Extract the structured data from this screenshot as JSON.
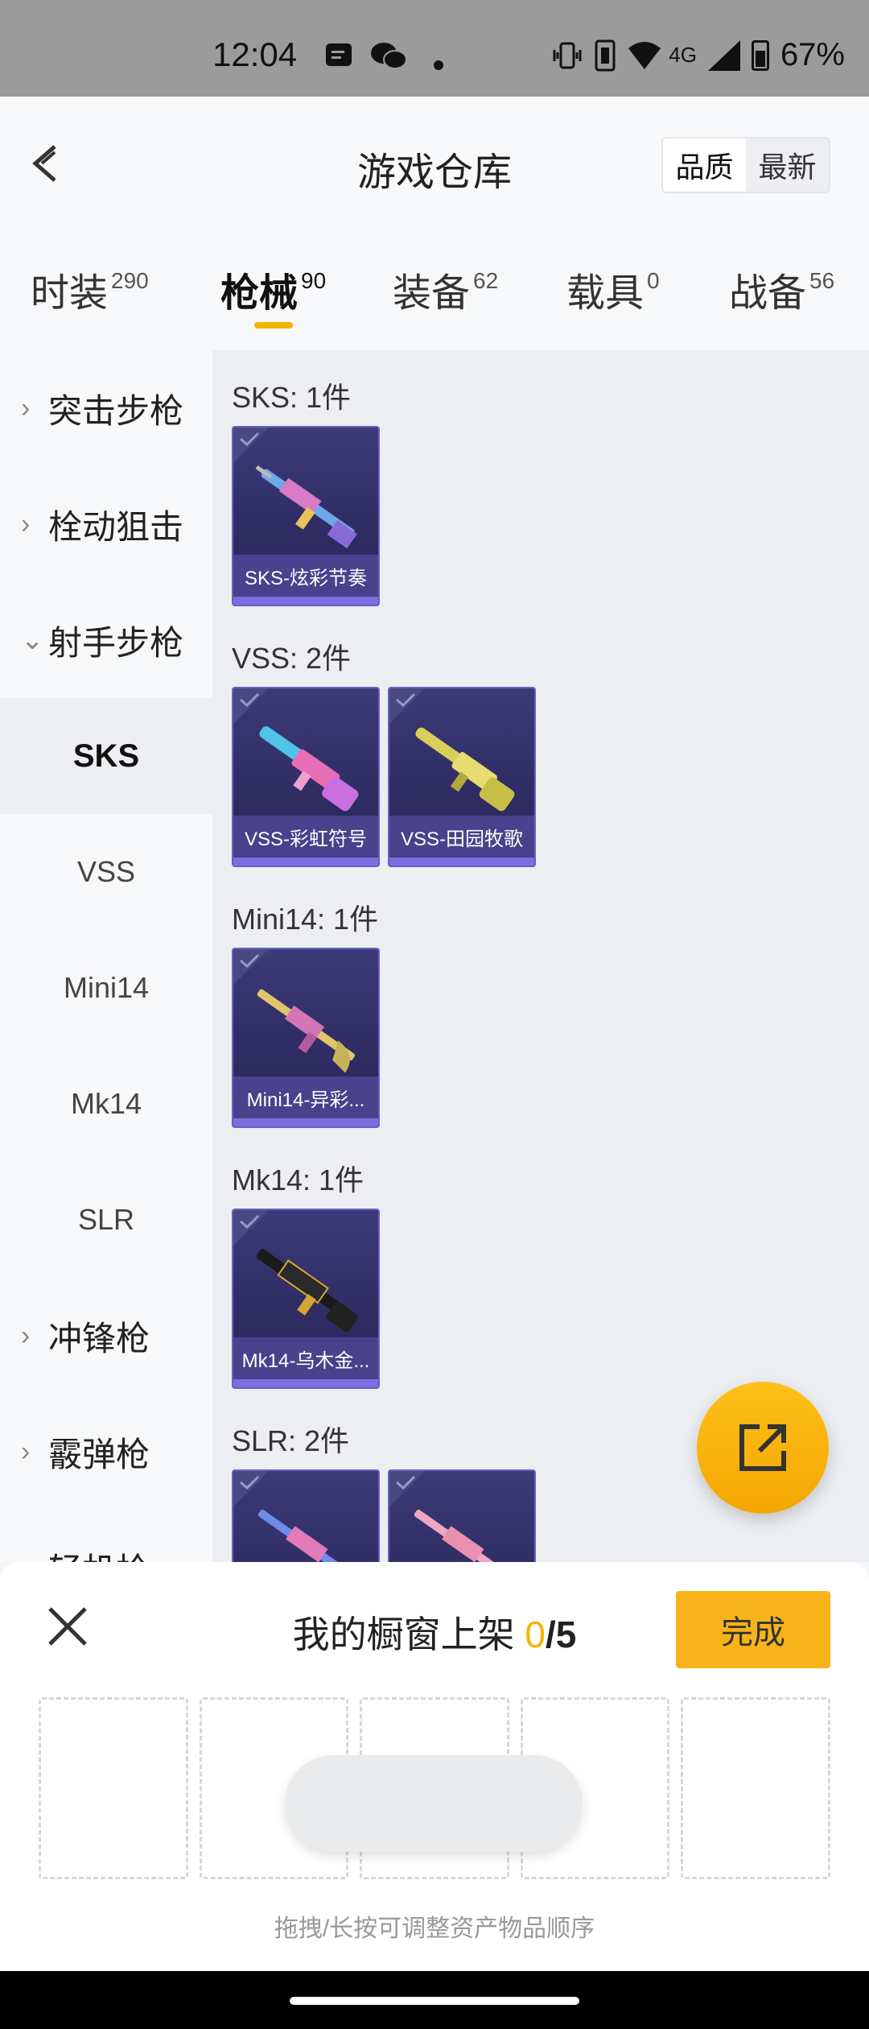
{
  "status_bar": {
    "time": "12:04",
    "battery": "67%",
    "network": "4G"
  },
  "header": {
    "title": "游戏仓库",
    "sort_options": [
      "品质",
      "最新"
    ],
    "selected_sort": "品质"
  },
  "tabs": [
    {
      "label": "时装",
      "count": "290"
    },
    {
      "label": "枪械",
      "count": "90"
    },
    {
      "label": "装备",
      "count": "62"
    },
    {
      "label": "载具",
      "count": "0"
    },
    {
      "label": "战备",
      "count": "56"
    }
  ],
  "active_tab": "枪械",
  "sidebar": {
    "groups": [
      "突击步枪",
      "栓动狙击",
      "射手步枪",
      "冲锋枪",
      "霰弹枪",
      "轻机枪"
    ],
    "subitems": [
      "SKS",
      "VSS",
      "Mini14",
      "Mk14",
      "SLR"
    ],
    "active_subitem": "SKS"
  },
  "sections": [
    {
      "title": "SKS: 1件",
      "items": [
        "SKS-炫彩节奏"
      ]
    },
    {
      "title": "VSS: 2件",
      "items": [
        "VSS-彩虹符号",
        "VSS-田园牧歌"
      ]
    },
    {
      "title": "Mini14: 1件",
      "items": [
        "Mini14-异彩..."
      ]
    },
    {
      "title": "Mk14: 1件",
      "items": [
        "Mk14-乌木金..."
      ]
    },
    {
      "title": "SLR: 2件",
      "items": [
        "",
        ""
      ]
    }
  ],
  "sheet": {
    "title": "我的橱窗上架",
    "count": "0",
    "total": "/5",
    "done_label": "完成",
    "hint": "拖拽/长按可调整资产物品顺序"
  },
  "colors": {
    "accent": "#f4b400",
    "card_bg": "#2f2c63",
    "card_border": "#6a5fc6"
  },
  "icons": {
    "fab": "share-icon",
    "back": "back-icon",
    "close": "close-icon"
  }
}
